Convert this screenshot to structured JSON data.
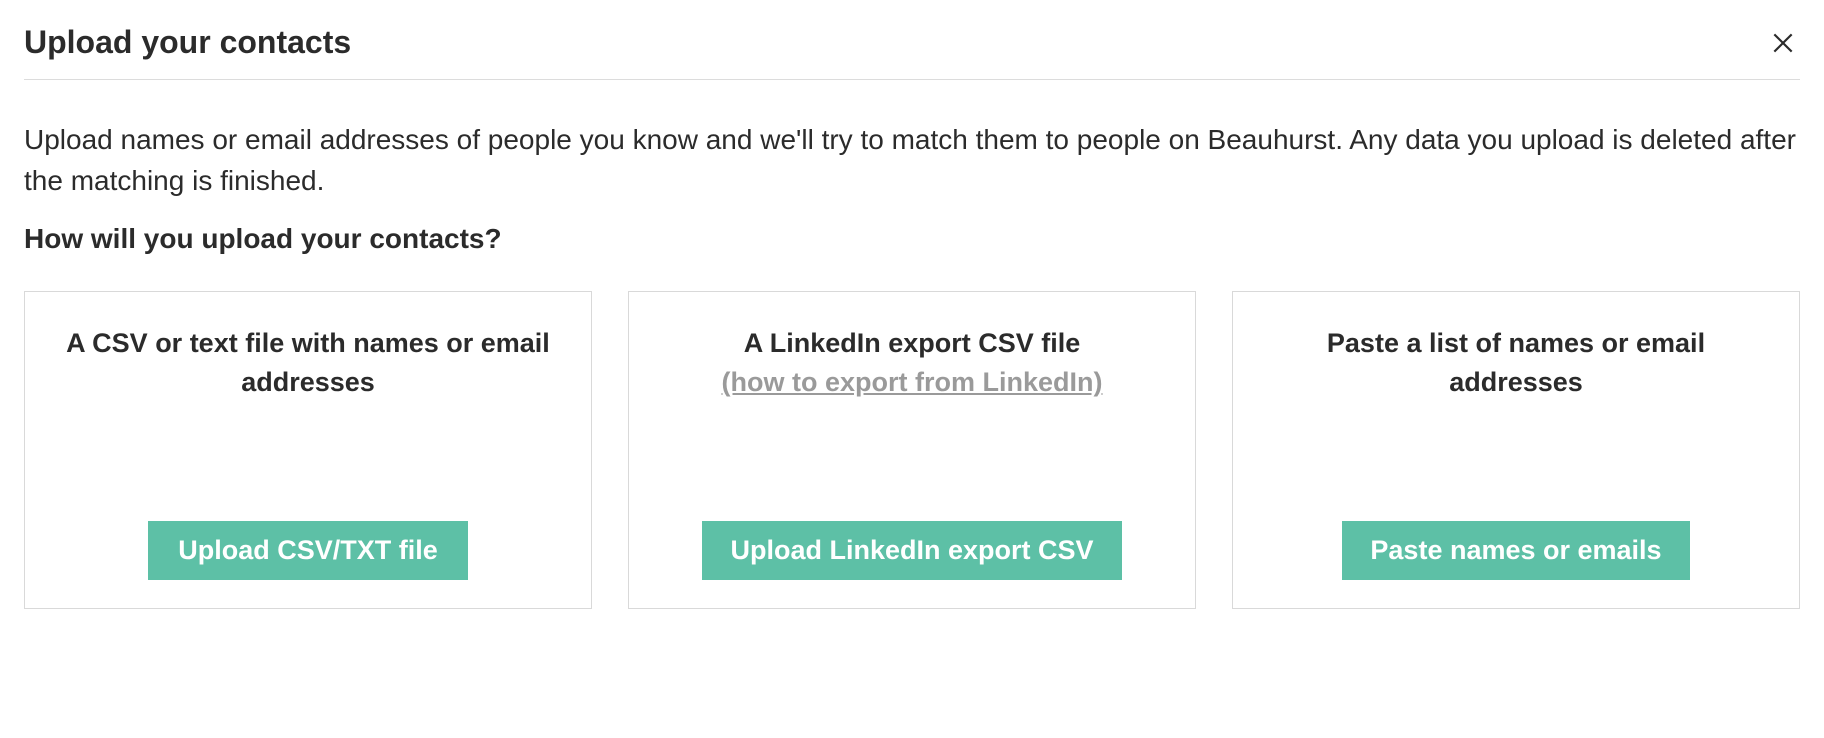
{
  "modal": {
    "title": "Upload your contacts",
    "description": "Upload names or email addresses of people you know and we'll try to match them to people on Beauhurst. Any data you upload is deleted after the matching is finished.",
    "subheading": "How will you upload your contacts?"
  },
  "options": [
    {
      "title": "A CSV or text file with names or email addresses",
      "sublink": "",
      "button": "Upload CSV/TXT file"
    },
    {
      "title": "A LinkedIn export CSV file",
      "sublink": "(how to export from LinkedIn)",
      "button": "Upload LinkedIn export CSV"
    },
    {
      "title": "Paste a list of names or email addresses",
      "sublink": "",
      "button": "Paste names or emails"
    }
  ]
}
